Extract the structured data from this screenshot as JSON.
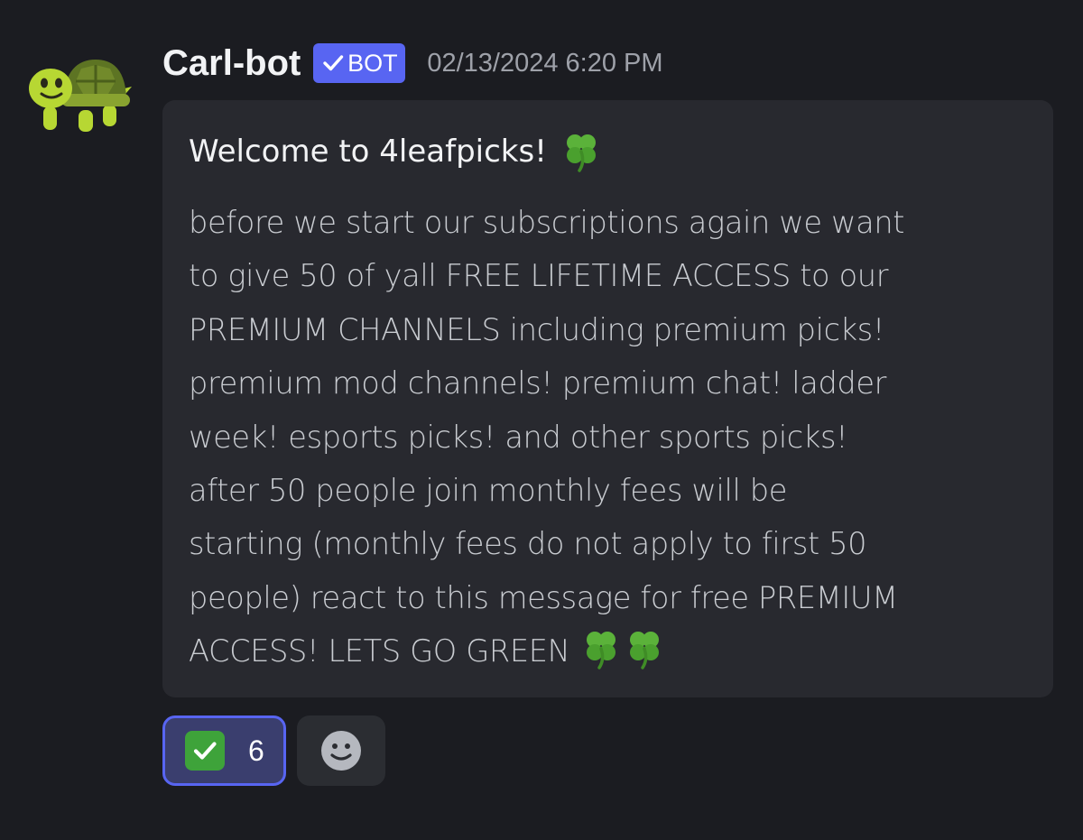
{
  "message": {
    "author": "Carl-bot",
    "bot_tag": "BOT",
    "timestamp": "02/13/2024 6:20 PM",
    "avatar_icon": "turtle-icon",
    "embed": {
      "title": "Welcome to 4leafpicks!",
      "title_emoji": "four-leaf-clover-icon",
      "description_lines": [
        "before we start our subscriptions again we want",
        "to give 50 of yall FREE LIFETIME ACCESS to our",
        "PREMIUM CHANNELS including premium picks!",
        "premium mod channels! premium chat! ladder",
        "week! esports picks! and other sports picks!",
        "after 50 people join monthly fees will be",
        "starting (monthly fees do not apply to first 50",
        "people) react to this message for free PREMIUM",
        "ACCESS! LETS GO GREEN"
      ],
      "trailing_emoji": [
        "four-leaf-clover-icon",
        "four-leaf-clover-icon"
      ]
    },
    "reactions": [
      {
        "emoji": "check-mark-button-icon",
        "count": "6",
        "active": true
      },
      {
        "emoji": "add-reaction-icon"
      }
    ]
  },
  "colors": {
    "background": "#1b1c21",
    "embed_background": "#28292f",
    "accent": "#5865f2",
    "timestamp": "#9ea1a9"
  }
}
